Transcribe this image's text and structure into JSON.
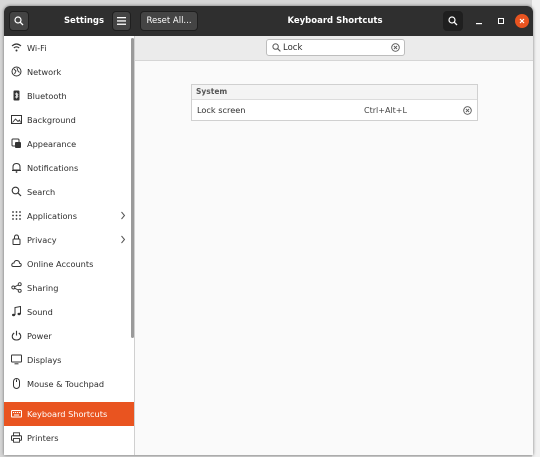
{
  "header": {
    "settings_title": "Settings",
    "reset_label": "Reset All...",
    "title": "Keyboard Shortcuts"
  },
  "sidebar": {
    "items": [
      {
        "label": "Wi-Fi",
        "icon": "wifi-icon"
      },
      {
        "label": "Network",
        "icon": "network-icon"
      },
      {
        "label": "Bluetooth",
        "icon": "bluetooth-icon"
      },
      {
        "label": "Background",
        "icon": "background-icon"
      },
      {
        "label": "Appearance",
        "icon": "appearance-icon"
      },
      {
        "label": "Notifications",
        "icon": "bell-icon"
      },
      {
        "label": "Search",
        "icon": "search-icon"
      },
      {
        "label": "Applications",
        "icon": "apps-grid-icon"
      },
      {
        "label": "Privacy",
        "icon": "lock-icon"
      },
      {
        "label": "Online Accounts",
        "icon": "cloud-icon"
      },
      {
        "label": "Sharing",
        "icon": "share-icon"
      },
      {
        "label": "Sound",
        "icon": "music-note-icon"
      },
      {
        "label": "Power",
        "icon": "power-icon"
      },
      {
        "label": "Displays",
        "icon": "display-icon"
      },
      {
        "label": "Mouse & Touchpad",
        "icon": "mouse-icon"
      },
      {
        "label": "Keyboard Shortcuts",
        "icon": "keyboard-icon"
      },
      {
        "label": "Printers",
        "icon": "printer-icon"
      }
    ],
    "active": "Keyboard Shortcuts"
  },
  "search": {
    "value": "Lock"
  },
  "shortcuts": {
    "group_title": "System",
    "rows": [
      {
        "name": "Lock screen",
        "accel": "Ctrl+Alt+L"
      }
    ]
  },
  "colors": {
    "accent": "#e95420",
    "header_bg": "#2f2f2f"
  }
}
